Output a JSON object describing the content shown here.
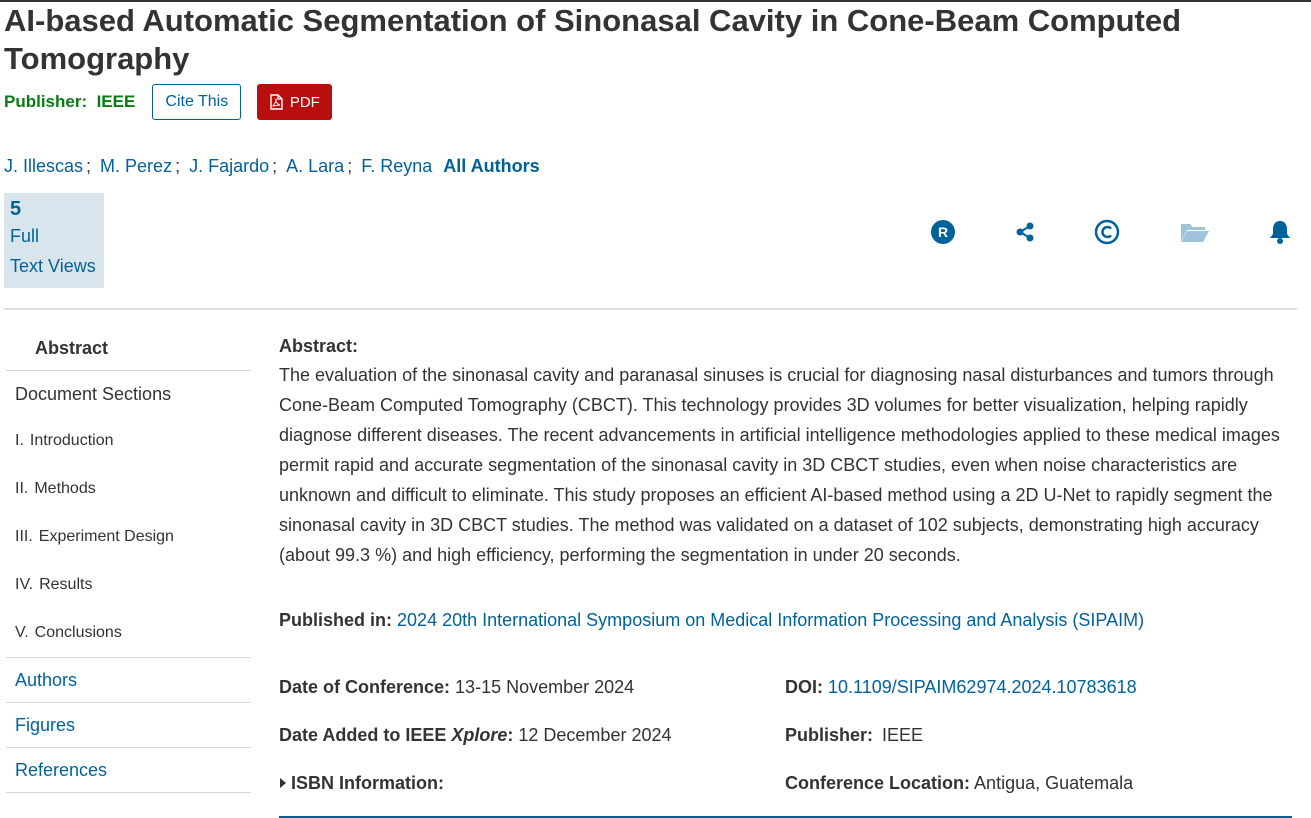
{
  "title": "AI-based Automatic Segmentation of Sinonasal Cavity in Cone-Beam Computed Tomography",
  "publisher_label": "Publisher:  IEEE",
  "cite_label": "Cite This",
  "pdf_label": "PDF",
  "authors": [
    "J. Illescas",
    "M. Perez",
    "J. Fajardo",
    "A. Lara",
    "F. Reyna"
  ],
  "author_separator": ";",
  "all_authors_label": "All Authors",
  "metrics": {
    "count": "5",
    "label_line1": "Full",
    "label_line2": "Text Views"
  },
  "action_icons": [
    "rights-icon",
    "share-icon",
    "copyright-icon",
    "folder-icon",
    "bell-icon"
  ],
  "nav": {
    "abstract": "Abstract",
    "document_sections": "Document Sections",
    "sections": [
      {
        "num": "I.",
        "label": "Introduction"
      },
      {
        "num": "II.",
        "label": "Methods"
      },
      {
        "num": "III.",
        "label": "Experiment Design"
      },
      {
        "num": "IV.",
        "label": "Results"
      },
      {
        "num": "V.",
        "label": "Conclusions"
      }
    ],
    "authors": "Authors",
    "figures": "Figures",
    "references": "References"
  },
  "abstract": {
    "heading": "Abstract:",
    "text": "The evaluation of the sinonasal cavity and paranasal sinuses is crucial for diagnosing nasal disturbances and tumors through Cone-Beam Computed Tomography (CBCT). This technology provides 3D volumes for better visualization, helping rapidly diagnose different diseases. The recent advancements in artificial intelligence methodologies applied to these medical images permit rapid and accurate segmentation of the sinonasal cavity in 3D CBCT studies, even when noise characteristics are unknown and difficult to eliminate. This study proposes an efficient AI-based method using a 2D U-Net to rapidly segment the sinonasal cavity in 3D CBCT studies. The method was validated on a dataset of 102 subjects, demonstrating high accuracy (about 99.3 %) and high efficiency, performing the segmentation in under 20 seconds."
  },
  "published_in": {
    "label": "Published in:",
    "value": "2024 20th International Symposium on Medical Information Processing and Analysis (SIPAIM)"
  },
  "details": {
    "date_conf_label": "Date of Conference:",
    "date_conf_value": "13-15 November 2024",
    "date_added_label_pre": "Date Added to IEEE ",
    "date_added_label_em": "Xplore",
    "date_added_label_post": ":",
    "date_added_value": "12 December 2024",
    "isbn_label": "ISBN Information:",
    "doi_label": "DOI:",
    "doi_value": "10.1109/SIPAIM62974.2024.10783618",
    "publisher_label": "Publisher:",
    "publisher_value": "IEEE",
    "location_label": "Conference Location:",
    "location_value": "Antigua, Guatemala"
  },
  "colors": {
    "link": "#00629b",
    "publisher": "#0a7b14",
    "pdf": "#b90e0e",
    "metrics_bg": "#d9e5ec"
  }
}
